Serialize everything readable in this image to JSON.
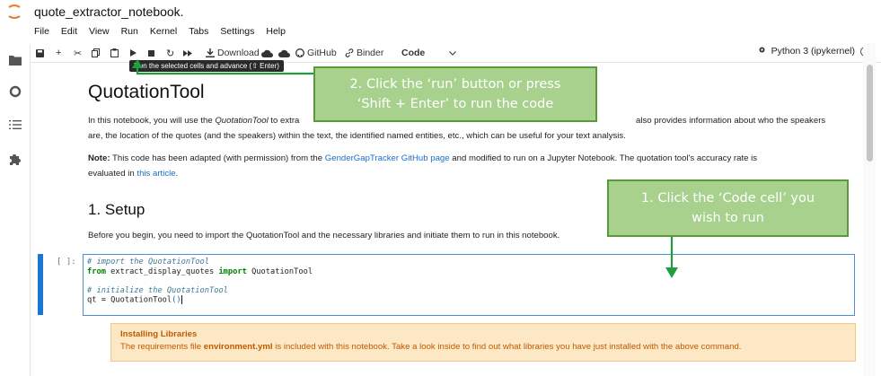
{
  "window": {
    "title": "quote_extractor_notebook."
  },
  "menu": [
    "File",
    "Edit",
    "View",
    "Run",
    "Kernel",
    "Tabs",
    "Settings",
    "Help"
  ],
  "toolbar": {
    "download_label": "Download",
    "github_label": "GitHub",
    "binder_label": "Binder",
    "cell_type": "Code",
    "kernel_label": "Python 3 (ipykernel)",
    "tooltip": "Run the selected cells and advance (⇧ Enter)"
  },
  "notebook": {
    "title": "QuotationTool",
    "intro_line1_pre": "In this notebook, you will use the ",
    "intro_line1_em": "QuotationTool",
    "intro_line1_mid": " to extra",
    "intro_line1_post": "also provides information about who the speakers",
    "intro_line2": "are, the location of the quotes (and the speakers) within the text, the identified named entities, etc., which can be useful for your text analysis.",
    "note_label": "Note:",
    "note_pre": " This code has been adapted (with permission) from the ",
    "note_link1": "GenderGapTracker GitHub page",
    "note_mid": " and modified to run on a Jupyter Notebook. The quotation tool's accuracy rate is",
    "note_line2_pre": "evaluated in ",
    "note_link2": "this article",
    "note_line2_post": ".",
    "setup_heading": "1. Setup",
    "setup_text": "Before you begin, you need to import the QuotationTool and the necessary libraries and initiate them to run in this notebook.",
    "cell_prompt": "[ ]:",
    "code": {
      "l1": "# import the QuotationTool",
      "l2_kw1": "from",
      "l2_mod": " extract_display_quotes ",
      "l2_kw2": "import",
      "l2_name": " QuotationTool",
      "l4": "# initialize the QuotationTool",
      "l5_pre": "qt = QuotationTool",
      "l5_paren": "()"
    },
    "alert_title": "Installing Libraries",
    "alert_pre": "The requirements file ",
    "alert_file": "environment.yml",
    "alert_post": " is included with this notebook. Take a look inside to find out what libraries you have just installed with the above command."
  },
  "annotations": {
    "run": {
      "line1": "2. Click the ‘run’ button or press",
      "line2": "‘Shift + Enter’ to run the code"
    },
    "code": {
      "line1": "1.  Click the ‘Code cell’ you",
      "line2": "wish to run"
    },
    "color_fill": "#a9d18e",
    "color_border": "#5b9a3c",
    "arrow_color": "#1e9e3c"
  },
  "colors": {
    "accent": "#1976d2",
    "link": "#1a6fc9",
    "alert_bg": "#fde8c6",
    "alert_text": "#c25a00"
  }
}
